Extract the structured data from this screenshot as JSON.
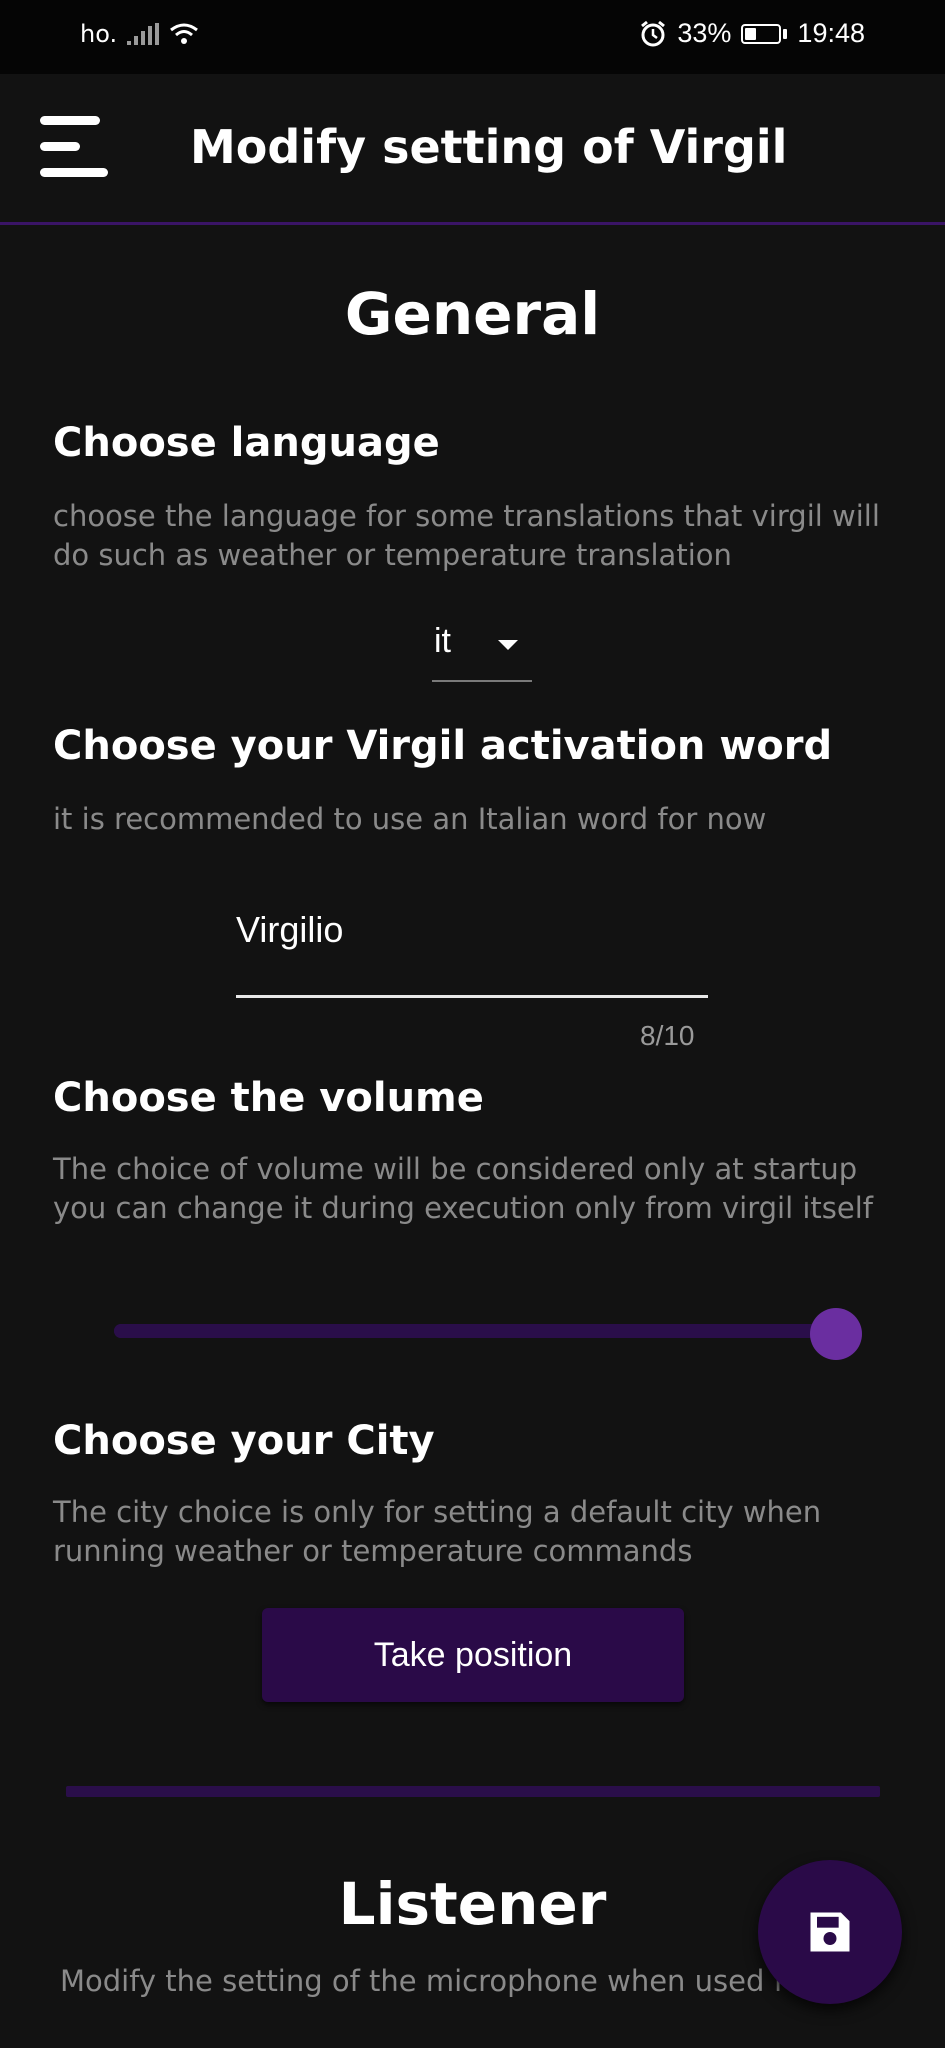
{
  "status_bar": {
    "carrier": "ho.",
    "battery_percent": "33%",
    "time": "19:48",
    "icons": [
      "signal-icon",
      "wifi-icon",
      "alarm-icon",
      "battery-icon"
    ]
  },
  "appbar": {
    "title": "Modify setting of Virgil",
    "menu_icon": "menu-icon"
  },
  "general": {
    "title": "General",
    "language": {
      "heading": "Choose language",
      "description": "choose the language for some translations that virgil will do such as weather or temperature translation",
      "selected": "it"
    },
    "activation_word": {
      "heading": "Choose your Virgil activation word",
      "description": "it is recommended to use an Italian word for now",
      "value": "Virgilio",
      "counter": "8/10"
    },
    "volume": {
      "heading": "Choose the volume",
      "description": "The choice of volume will be considered only at startup you can change it during execution only from virgil itself",
      "level": 1.0
    },
    "city": {
      "heading": "Choose your City",
      "description": "The city choice is only for setting a default city when running weather or temperature commands",
      "button_label": "Take position"
    }
  },
  "listener": {
    "title": "Listener",
    "description": "Modify the setting of the microphone when used for"
  },
  "fab": {
    "icon": "save-icon"
  },
  "colors": {
    "background": "#121212",
    "accent": "#2a0a48",
    "slider_thumb": "#6a2ea0"
  }
}
